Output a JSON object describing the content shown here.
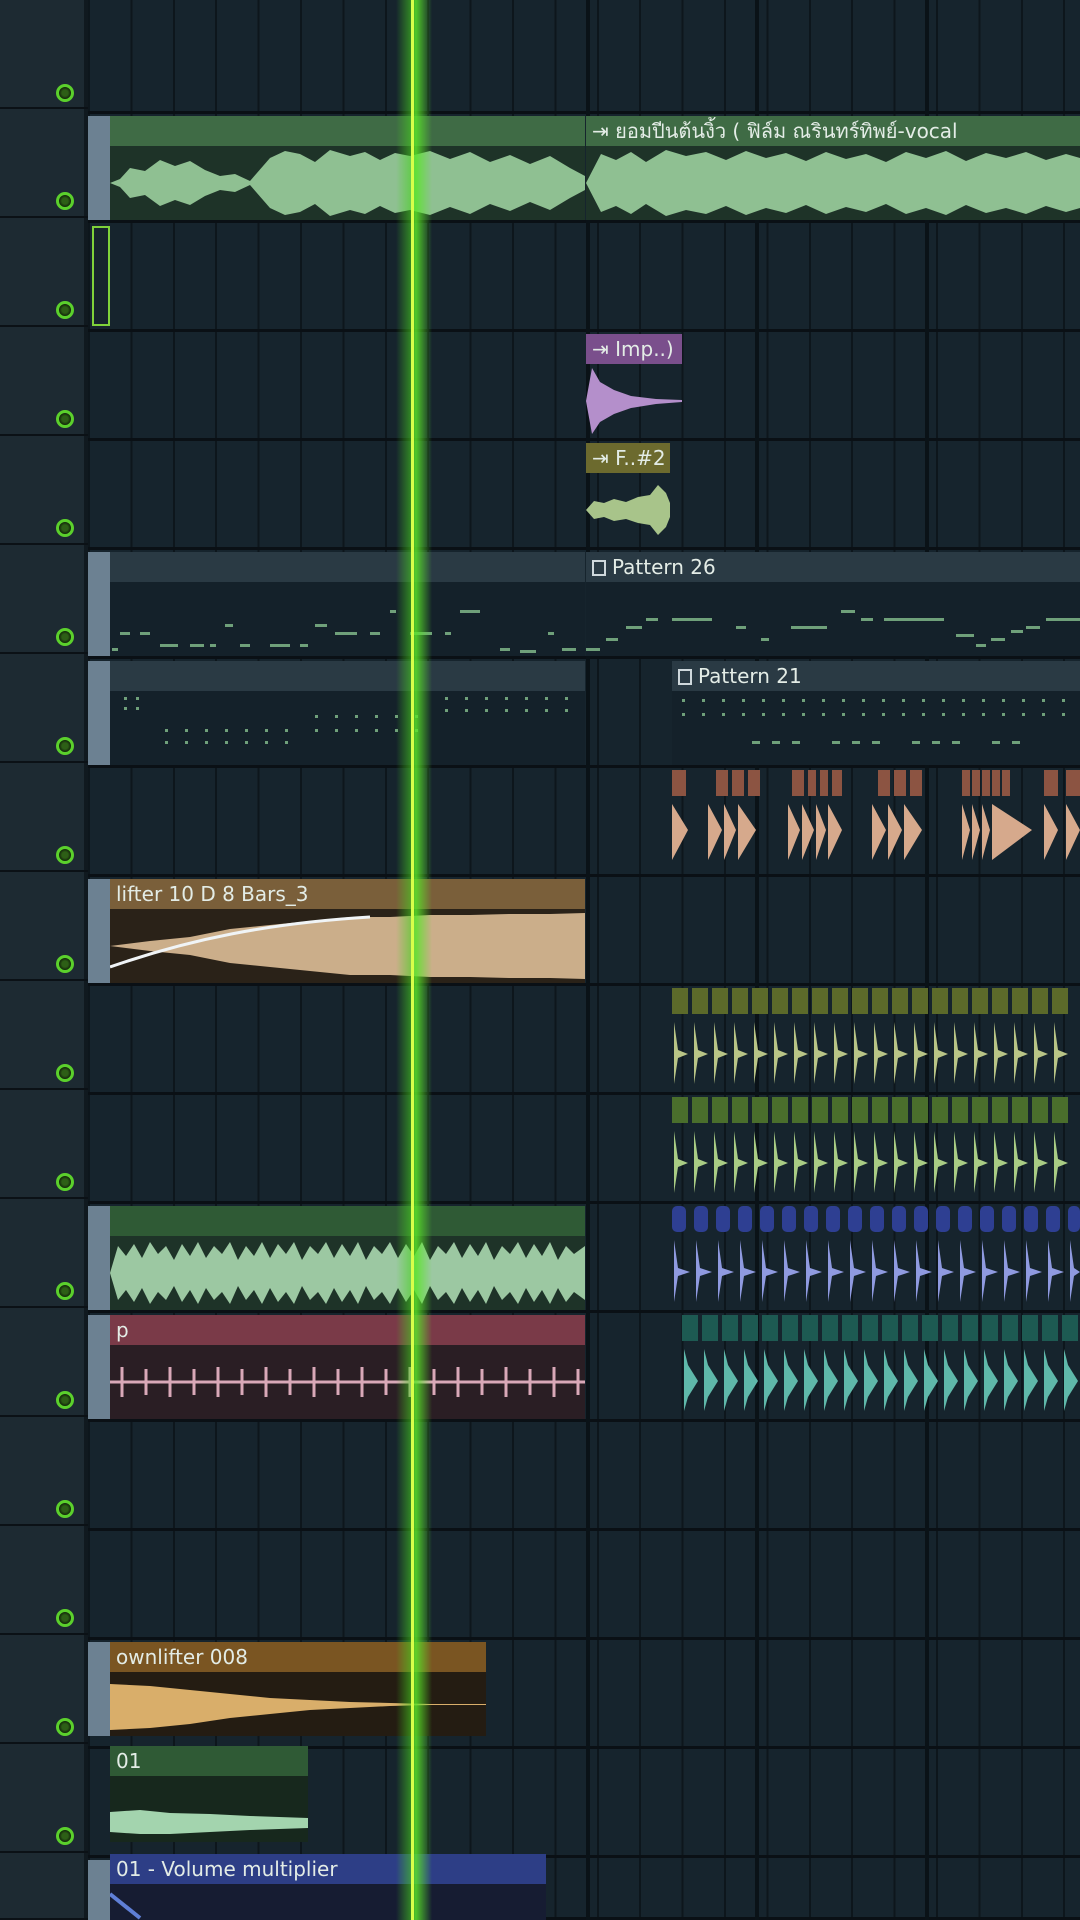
{
  "playlist": {
    "tracks": [
      {
        "id": 1
      },
      {
        "id": 2
      },
      {
        "id": 3
      },
      {
        "id": 4
      },
      {
        "id": 5
      },
      {
        "id": 6
      },
      {
        "id": 7
      },
      {
        "id": 8
      },
      {
        "id": 9
      },
      {
        "id": 10
      },
      {
        "id": 11
      },
      {
        "id": 12
      },
      {
        "id": 13
      },
      {
        "id": 14
      },
      {
        "id": 15
      },
      {
        "id": 16
      },
      {
        "id": 17
      },
      {
        "id": 18
      }
    ],
    "clips": {
      "vocal": {
        "label": "ยอมปีนต้นงิ้ว ( ฟิล์ม ณรินทร์ทิพย์-vocal",
        "color": "#3f6b45"
      },
      "imp": {
        "label": "Imp..)",
        "color": "#7a4f8c"
      },
      "fx2": {
        "label": "F..#2",
        "color": "#6c6a2e"
      },
      "pattern26": {
        "label": "Pattern 26",
        "color": "#2a3a44"
      },
      "pattern21": {
        "label": "Pattern 21",
        "color": "#2a3a44"
      },
      "uplifter": {
        "label": "lifter 10 D 8 Bars_3",
        "color": "#7a5f3a"
      },
      "loopP": {
        "label": "p",
        "color": "#7a3a48"
      },
      "downlifter": {
        "label": "ownlifter 008",
        "color": "#7a5522"
      },
      "clip01": {
        "label": "01",
        "color": "#2f5a35"
      },
      "volume": {
        "label": "01 - Volume multiplier",
        "color": "#2d3e86"
      }
    }
  }
}
